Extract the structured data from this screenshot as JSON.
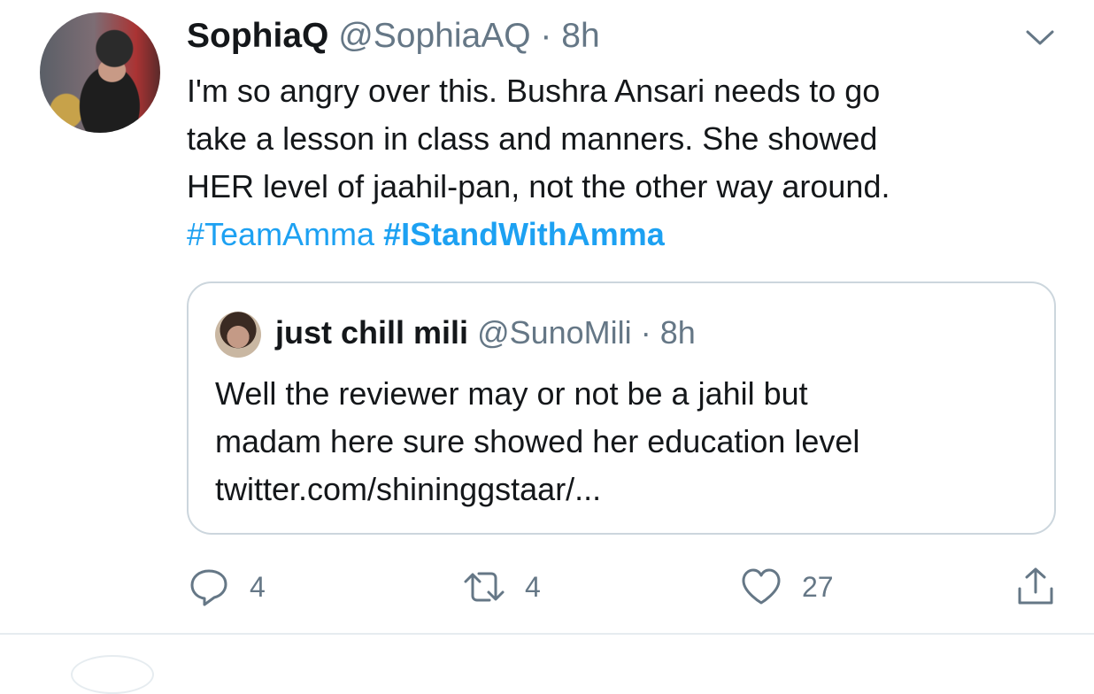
{
  "tweet": {
    "name": "SophiaQ",
    "handle": "@SophiaAQ",
    "separator": "·",
    "time": "8h",
    "text_lines": [
      "I'm so angry over this.  Bushra Ansari needs to go",
      "take a lesson in class and manners.  She showed",
      "HER level of jaahil-pan, not the other way around."
    ],
    "hashtags": [
      "#TeamAmma",
      "#IStandWithAmma"
    ]
  },
  "quote": {
    "name": "just chill mili",
    "handle": "@SunoMili",
    "separator": "·",
    "time": "8h",
    "text_lines": [
      "Well the reviewer may or not be a jahil but",
      "madam here sure showed her education level",
      "twitter.com/shininggstaar/..."
    ]
  },
  "actions": {
    "reply_count": "4",
    "retweet_count": "4",
    "like_count": "27"
  },
  "icons": {
    "caret": "chevron-down-icon",
    "reply": "reply-icon",
    "retweet": "retweet-icon",
    "like": "heart-icon",
    "share": "share-icon"
  },
  "colors": {
    "accent": "#1da1f2",
    "muted": "#657786",
    "border": "#ccd6dd"
  }
}
